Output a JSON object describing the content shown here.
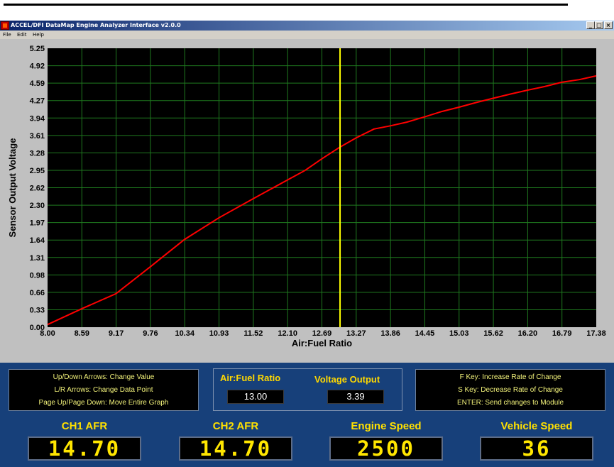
{
  "window": {
    "title": "ACCEL/DFI DataMap Engine Analyzer Interface  v2.0.0",
    "controls": {
      "minimize": "_",
      "maximize": "□",
      "close": "×"
    }
  },
  "menu": [
    "File",
    "Edit",
    "Help"
  ],
  "chart_data": {
    "type": "line",
    "xlabel": "Air:Fuel Ratio",
    "ylabel": "Sensor Output Voltage",
    "x_ticks": [
      "8.00",
      "8.59",
      "9.17",
      "9.76",
      "10.34",
      "10.93",
      "11.52",
      "12.10",
      "12.69",
      "13.27",
      "13.86",
      "14.45",
      "15.03",
      "15.62",
      "16.20",
      "16.79",
      "17.38"
    ],
    "y_ticks": [
      "0.00",
      "0.33",
      "0.66",
      "0.98",
      "1.31",
      "1.64",
      "1.97",
      "2.30",
      "2.62",
      "2.95",
      "3.28",
      "3.61",
      "3.94",
      "4.27",
      "4.59",
      "4.92",
      "5.25"
    ],
    "xlim": [
      8.0,
      17.38
    ],
    "ylim": [
      0.0,
      5.25
    ],
    "grid": true,
    "background": "#000000",
    "grid_color": "#1f7a1f",
    "series": [
      {
        "color": "#ff0000",
        "x": [
          8.0,
          8.59,
          9.17,
          9.76,
          10.34,
          10.93,
          11.52,
          12.1,
          12.4,
          12.69,
          13.0,
          13.27,
          13.58,
          13.86,
          14.14,
          14.45,
          14.74,
          15.03,
          15.33,
          15.62,
          15.92,
          16.2,
          16.5,
          16.79,
          17.09,
          17.38
        ],
        "y": [
          0.05,
          0.35,
          0.63,
          1.14,
          1.65,
          2.06,
          2.42,
          2.77,
          2.95,
          3.17,
          3.39,
          3.56,
          3.73,
          3.79,
          3.86,
          3.96,
          4.06,
          4.14,
          4.23,
          4.31,
          4.39,
          4.46,
          4.53,
          4.61,
          4.66,
          4.73
        ]
      }
    ],
    "cursor": {
      "x": 13.0,
      "color": "#ffff00"
    }
  },
  "help_left": [
    "Up/Down Arrows:  Change Value",
    "L/R Arrows:  Change Data Point",
    "Page Up/Page Down:  Move Entire Graph"
  ],
  "help_right": [
    "F Key: Increase Rate of Change",
    "S Key: Decrease Rate of Change",
    "ENTER:  Send changes to Module"
  ],
  "readouts": {
    "afr_label": "Air:Fuel Ratio",
    "afr_value": "13.00",
    "voltage_label": "Voltage Output",
    "voltage_value": "3.39"
  },
  "gauges": [
    {
      "label": "CH1 AFR",
      "value": "14.70"
    },
    {
      "label": "CH2 AFR",
      "value": "14.70"
    },
    {
      "label": "Engine Speed",
      "value": "2500"
    },
    {
      "label": "Vehicle Speed",
      "value": "36"
    }
  ],
  "colors": {
    "panel": "#17407a",
    "gauge_text": "#ffe600",
    "label_text": "#ffd800",
    "help_text": "#f2f27a"
  }
}
